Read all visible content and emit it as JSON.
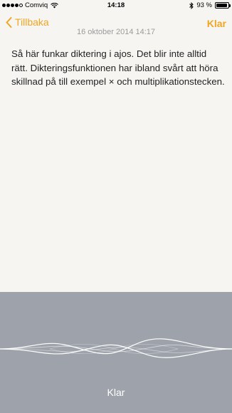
{
  "status_bar": {
    "carrier": "Comviq",
    "time": "14:18",
    "battery_percent_text": "93 %",
    "battery_level": 0.93,
    "icons": [
      "signal-dots-icon",
      "wifi-icon",
      "bluetooth-icon",
      "battery-icon"
    ]
  },
  "nav": {
    "back_label": "Tillbaka",
    "done_label": "Klar",
    "accent_color": "#f0a623"
  },
  "note": {
    "date": "16 oktober 2014 14:17",
    "text": "Så här funkar diktering i ajos. Det blir inte alltid rätt. Dikteringsfunktionen har ibland svårt att höra skillnad på till exempel × och multiplikationstecken."
  },
  "dictation": {
    "done_label": "Klar",
    "panel_color": "#9ea3ab"
  }
}
